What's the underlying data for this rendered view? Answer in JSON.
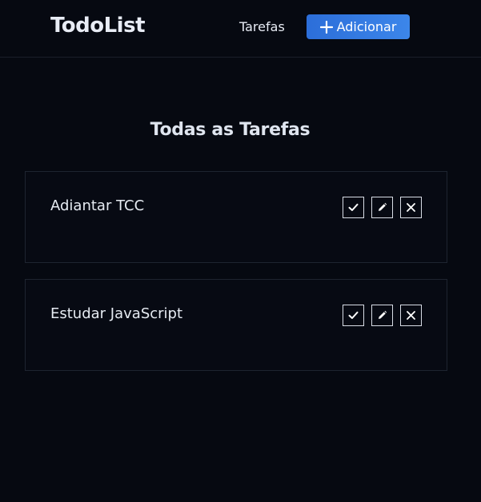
{
  "header": {
    "logo": "TodoList",
    "nav_tasks": "Tarefas",
    "add_button_label": "Adicionar"
  },
  "main": {
    "title": "Todas as Tarefas",
    "tasks": [
      {
        "title": "Adiantar TCC"
      },
      {
        "title": "Estudar JavaScript"
      }
    ]
  },
  "icons": {
    "add": "plus-icon",
    "complete": "check-icon",
    "edit": "pencil-icon",
    "delete": "close-icon"
  },
  "colors": {
    "background": "#060911",
    "accent": "#2c6ed9",
    "text": "#e6ebf2"
  }
}
